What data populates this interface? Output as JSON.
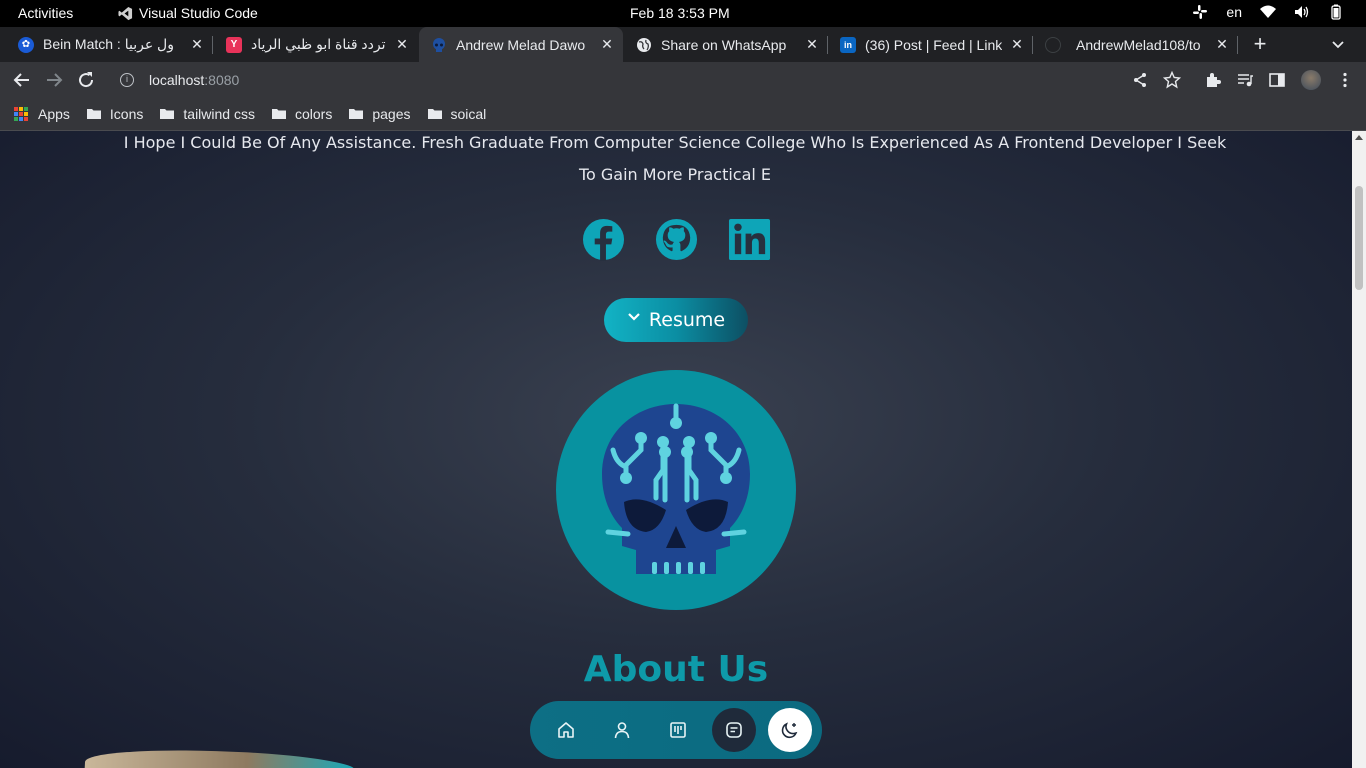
{
  "system_bar": {
    "activities": "Activities",
    "app_name": "Visual Studio Code",
    "clock": "Feb 18  3:53 PM",
    "language": "en"
  },
  "tabs": [
    {
      "title": "Bein Match : ول عربيا",
      "favicon": "bein-icon",
      "favicon_color": "#1a5bd6",
      "active": false
    },
    {
      "title": "تردد قناة ابو ظبي الرياد",
      "favicon": "y-icon",
      "favicon_color": "#e8335a",
      "active": false
    },
    {
      "title": "Andrew Melad Dawo",
      "favicon": "skull-logo-icon",
      "favicon_color": "#1e4fa0",
      "active": true
    },
    {
      "title": "Share on WhatsApp",
      "favicon": "globe-icon",
      "favicon_color": "#e8eaed",
      "active": false
    },
    {
      "title": "(36) Post | Feed | Link",
      "favicon": "linkedin-icon",
      "favicon_color": "#0a66c2",
      "active": false
    },
    {
      "title": "AndrewMelad108/to",
      "favicon": "github-icon",
      "favicon_color": "#202124",
      "active": false
    }
  ],
  "address_bar": {
    "host": "localhost",
    "port": ":8080"
  },
  "bookmarks": [
    {
      "label": "Apps",
      "icon": "apps-grid-icon"
    },
    {
      "label": "Icons",
      "icon": "folder-icon"
    },
    {
      "label": "tailwind css",
      "icon": "folder-icon"
    },
    {
      "label": "colors",
      "icon": "folder-icon"
    },
    {
      "label": "pages",
      "icon": "folder-icon"
    },
    {
      "label": "soical",
      "icon": "folder-icon"
    }
  ],
  "page": {
    "intro": "I Hope I Could Be Of Any Assistance. Fresh Graduate From Computer Science College Who Is Experienced As A Frontend Developer I Seek To Gain More Practical E",
    "socials": [
      "facebook-icon",
      "github-icon",
      "linkedin-icon"
    ],
    "resume_label": "Resume",
    "about_heading": "About Us",
    "dock": [
      "home-icon",
      "user-icon",
      "projects-icon",
      "blog-icon",
      "moon-icon"
    ]
  },
  "colors": {
    "accent": "#0e9aa9",
    "page_bg_center": "#3a4150",
    "page_bg_edge": "#161b2d",
    "browser_chrome": "#35363a"
  }
}
